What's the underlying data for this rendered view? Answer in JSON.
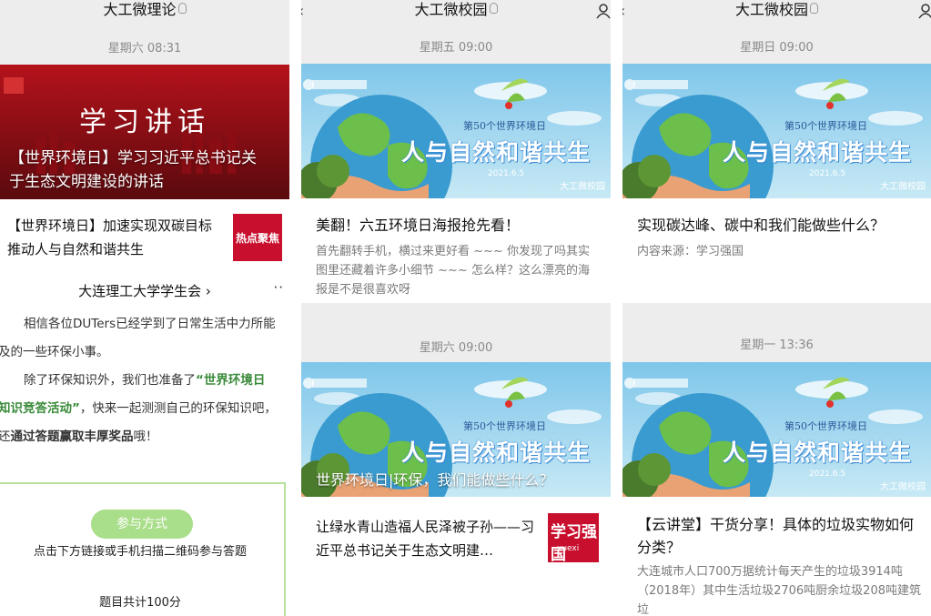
{
  "colors": {
    "panel_bg": "#ededed",
    "highlight": "#3a8a3a",
    "button": "#a9de8a",
    "thumb_red": "#c8102e"
  },
  "panel1": {
    "title": "大工微理论",
    "time": "星期六 08:31",
    "lead": {
      "banner_text": "学习讲话",
      "title": "【世界环境日】学习习近平总书记关于生态文明建设的讲话"
    },
    "item": {
      "title": "【世界环境日】加速实现双碳目标 推动人与自然和谐共生",
      "thumb_text": "热点聚焦"
    },
    "post": {
      "account": "大连理工大学学生会",
      "account_arrow": "›",
      "more": "··",
      "p1": "相信各位DUTers已经学到了日常生活中力所能及的一些环保小事。",
      "p2_a": "除了环保知识外，我们也准备了",
      "p2_b": "“世界环境日知识竞答活动”",
      "p2_c": "，快来一起测测自己的环保知识吧，还",
      "p2_d": "通过答题赢取丰厚奖品",
      "p2_e": "哦！",
      "button": "参与方式",
      "line1": "点击下方链接或手机扫描二维码参与答题",
      "line2": "题目共计100分"
    }
  },
  "panel2": {
    "title": "大工微校园",
    "back_icon": "back-chevron-icon",
    "card1": {
      "time": "星期五 09:00",
      "poster_line1": "第50个世界环境日",
      "poster_line2": "人与自然和谐共生",
      "poster_date": "2021.6.5",
      "watermark": "大工微校园",
      "title": "美翻！六五环境日海报抢先看！",
      "desc": "首先翻转手机，横过来更好看 ~~~ 你发现了吗其实图里还藏着许多小细节 ~~~ 怎么样？这么漂亮的海报是不是很喜欢呀"
    },
    "card2": {
      "time": "星期六 09:00",
      "poster_line1": "第50个世界环境日",
      "poster_line2": "人与自然和谐共生",
      "overlay": "世界环境日|环保，我们能做些什么？",
      "item_title": "让绿水青山造福人民泽被子孙——习近平总书记关于生态文明建…",
      "thumb_text": "学习强国",
      "thumb_sub": "xuexi"
    }
  },
  "panel3": {
    "title": "大工微校园",
    "card1": {
      "time": "星期日 09:00",
      "poster_line1": "第50个世界环境日",
      "poster_line2": "人与自然和谐共生",
      "poster_date": "2021.6.5",
      "watermark": "大工微校园",
      "title": "实现碳达峰、碳中和我们能做些什么？",
      "desc": "内容来源：学习强国"
    },
    "card2": {
      "time": "星期一 13:36",
      "poster_line1": "第50个世界环境日",
      "poster_line2": "人与自然和谐共生",
      "poster_date": "2021.6.5",
      "watermark": "大工微校园",
      "title": "【云讲堂】干货分享！具体的垃圾实物如何分类？",
      "desc": "大连城市人口700万据统计每天产生的垃圾3914吨（2018年）其中生活垃圾2706吨厨余垃圾208吨建筑垃"
    }
  }
}
